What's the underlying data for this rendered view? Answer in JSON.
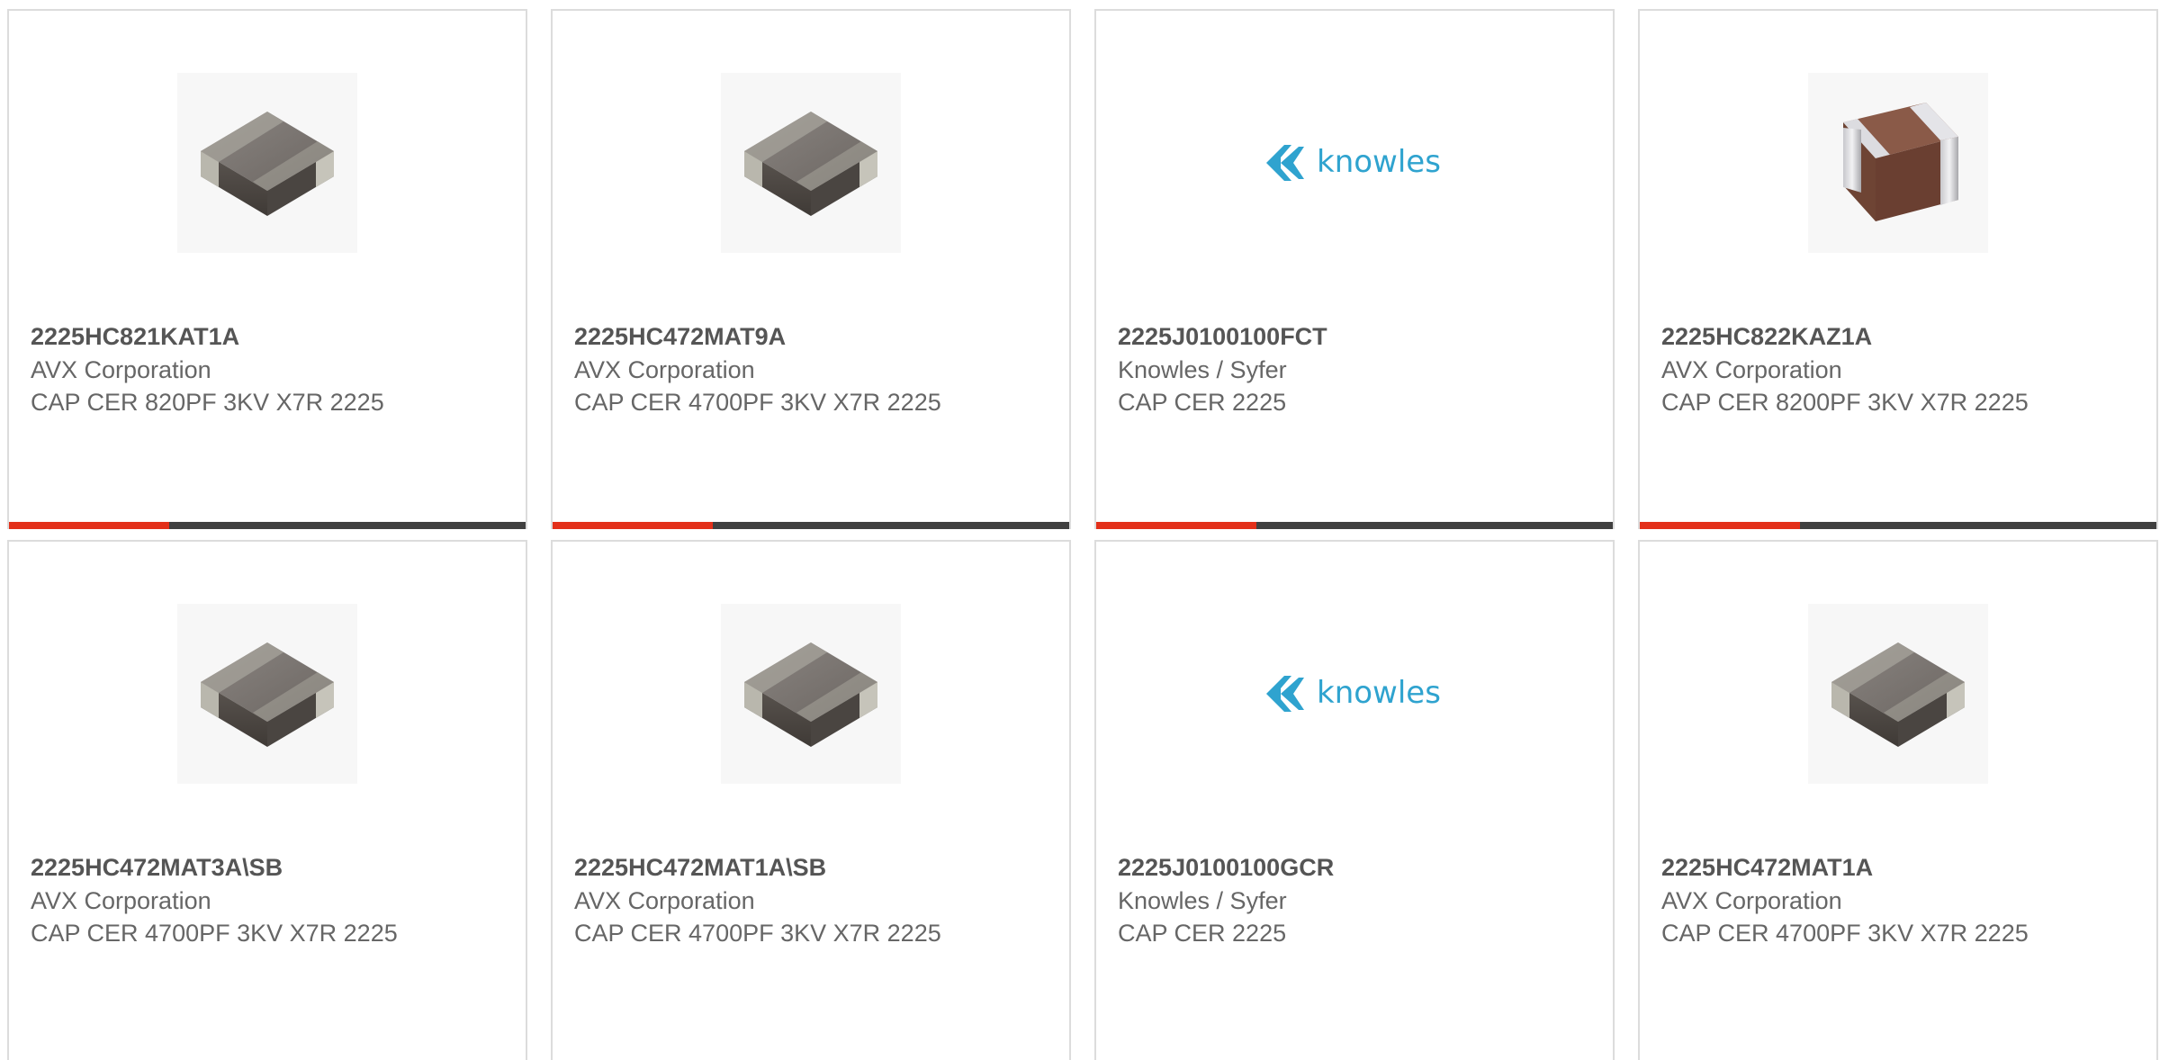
{
  "products": [
    {
      "part_number": "2225HC821KAT1A",
      "manufacturer": "AVX Corporation",
      "description": "CAP CER 820PF 3KV X7R 2225",
      "image": "chip-capacitor-gray-icon",
      "progress": 0.31,
      "colors": {
        "accent": "#e3301a",
        "track": "#404040"
      }
    },
    {
      "part_number": "2225HC472MAT9A",
      "manufacturer": "AVX Corporation",
      "description": "CAP CER 4700PF 3KV X7R 2225",
      "image": "chip-capacitor-gray-icon",
      "progress": 0.31
    },
    {
      "part_number": "2225J0100100FCT",
      "manufacturer": "Knowles / Syfer",
      "description": "CAP CER 2225",
      "image": "knowles-logo",
      "logo_text": "knowles",
      "progress": 0.31
    },
    {
      "part_number": "2225HC822KAZ1A",
      "manufacturer": "AVX Corporation",
      "description": "CAP CER 8200PF 3KV X7R 2225",
      "image": "chip-capacitor-brown-icon",
      "progress": 0.31
    },
    {
      "part_number": "2225HC472MAT3A\\SB",
      "manufacturer": "AVX Corporation",
      "description": "CAP CER 4700PF 3KV X7R 2225",
      "image": "chip-capacitor-gray-icon"
    },
    {
      "part_number": "2225HC472MAT1A\\SB",
      "manufacturer": "AVX Corporation",
      "description": "CAP CER 4700PF 3KV X7R 2225",
      "image": "chip-capacitor-gray-icon"
    },
    {
      "part_number": "2225J0100100GCR",
      "manufacturer": "Knowles / Syfer",
      "description": "CAP CER 2225",
      "image": "knowles-logo",
      "logo_text": "knowles"
    },
    {
      "part_number": "2225HC472MAT1A",
      "manufacturer": "AVX Corporation",
      "description": "CAP CER 4700PF 3KV X7R 2225",
      "image": "chip-capacitor-gray-icon"
    }
  ]
}
